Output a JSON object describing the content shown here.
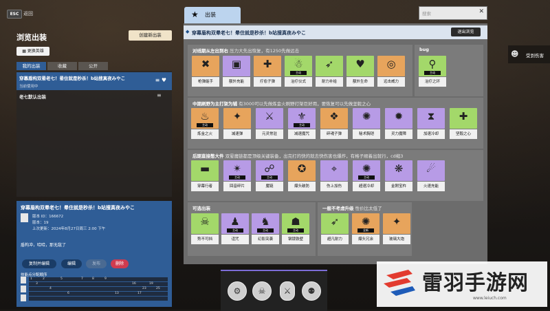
{
  "top": {
    "esc": "ESC",
    "back": "返回"
  },
  "left": {
    "title": "浏览出装",
    "new_button": "创建新出装",
    "swap_button": "更换英雄",
    "tabs": [
      {
        "label": "我的出装"
      },
      {
        "label": "收藏"
      },
      {
        "label": "公开"
      }
    ],
    "selected": {
      "title": "穿幕盾构双晕老七！晕住就是秒杀！b站搜真夜みやこ",
      "status": "当前使用中"
    },
    "default_build": "老七默认出装"
  },
  "card": {
    "title": "穿幕盾构双晕老七！晕住就是秒杀！b站搜真夜みやこ",
    "version_id": "版本 ID：166672",
    "version": "版本：19",
    "updated": "上次更新：2024年8月27日周三 2:00 下午",
    "desc": "盾构冲，哈哈，那无敌了",
    "buttons": {
      "copy_edit": "复制并编辑",
      "edit": "编辑",
      "publish": "发布",
      "delete": "删除"
    },
    "seq_label": "技能点分配顺序",
    "seq_row_labels": [
      [
        "1",
        "2",
        "5",
        "7",
        "8",
        "9",
        "10",
        "11",
        "12",
        "15"
      ],
      [
        "3",
        "16",
        "19",
        "21",
        "22"
      ],
      [
        "4",
        "23",
        "25",
        "26",
        "27"
      ],
      [
        "6",
        "13",
        "17",
        "18",
        "20"
      ]
    ]
  },
  "main": {
    "tab_label": "出装",
    "search_placeholder": "搜索",
    "build_name": "穿幕盾构双晕老七！晕住就是秒杀！b站搜真夜みやこ",
    "exit_button": "退出浏览",
    "sections": [
      {
        "title": "对线期从左出到右",
        "note": "压力大先出恢复，有1250先做远击",
        "items": [
          {
            "label": "枪弹能手",
            "color": "orange",
            "glyph": "✖"
          },
          {
            "label": "额外充能",
            "color": "purple",
            "glyph": "▣"
          },
          {
            "label": "疗愈子弹",
            "color": "orange",
            "glyph": "✚"
          },
          {
            "label": "治疗仪式",
            "color": "green",
            "glyph": "☃",
            "tag": "主动"
          },
          {
            "label": "耐力补给",
            "color": "green",
            "glyph": "➶"
          },
          {
            "label": "额外生命",
            "color": "green",
            "glyph": "♥"
          },
          {
            "label": "远击威力",
            "color": "orange",
            "glyph": "◎"
          }
        ]
      },
      {
        "title": "bug",
        "note": "",
        "items": [
          {
            "label": "治疗之环",
            "color": "green",
            "glyph": "⚲",
            "tag": "主动"
          }
        ]
      },
      {
        "title": "中期刷野为主打架为辅",
        "note": "有3000可以先做炼金火刷野打架巨好用，要恢复可以先做坚毅之心",
        "items": [
          {
            "label": "炼金之火",
            "color": "orange",
            "glyph": "♨",
            "tag": "主动"
          },
          {
            "label": "减速弹",
            "color": "orange",
            "glyph": "✦"
          },
          {
            "label": "元灵常驻",
            "color": "purple",
            "glyph": "⚔"
          },
          {
            "label": "减速魔咒",
            "color": "purple",
            "glyph": "⚜",
            "tag": "主动"
          },
          {
            "label": "碎魂子弹",
            "color": "orange",
            "glyph": "❖"
          },
          {
            "label": "秘术胸铠",
            "color": "purple",
            "glyph": "✺"
          },
          {
            "label": "灵力魔障",
            "color": "purple",
            "glyph": "✹"
          },
          {
            "label": "加速冷却",
            "color": "purple",
            "glyph": "⧗"
          },
          {
            "label": "坚毅之心",
            "color": "green",
            "glyph": "✚"
          }
        ]
      },
      {
        "title": "后期直接憋大件",
        "note": "双晕魔链都是顶级关键装备，出完打的快的就去快伤害也爆炸，有格子顺着出就行，cd缩3",
        "items": [
          {
            "label": "穿幕行者",
            "color": "green",
            "glyph": "▬"
          },
          {
            "label": "回音碎片",
            "color": "purple",
            "glyph": "✴",
            "tag": "主动"
          },
          {
            "label": "魔链",
            "color": "purple",
            "glyph": "☍",
            "tag": "主动"
          },
          {
            "label": "爆头破防",
            "color": "orange",
            "glyph": "✪"
          },
          {
            "label": "伤上加伤",
            "color": "purple",
            "glyph": "⌖"
          },
          {
            "label": "超速冷却",
            "color": "purple",
            "glyph": "✺",
            "tag": "主动"
          },
          {
            "label": "金刚宝杵",
            "color": "purple",
            "glyph": "❋"
          },
          {
            "label": "火速充能",
            "color": "purple",
            "glyph": "☄"
          }
        ]
      },
      {
        "title": "可选出装",
        "note": "",
        "items": [
          {
            "label": "势不可挡",
            "color": "green",
            "glyph": "☠"
          },
          {
            "label": "诅咒",
            "color": "purple",
            "glyph": "♟",
            "tag": "主动"
          },
          {
            "label": "幻影突袭",
            "color": "purple",
            "glyph": "♞",
            "tag": "主动"
          },
          {
            "label": "钢镜铁壁",
            "color": "green",
            "glyph": "☗",
            "tag": "主动"
          }
        ]
      },
      {
        "title": "一般不考虑升级",
        "note": "性价比太低了",
        "items": [
          {
            "label": "超凡耐力",
            "color": "green",
            "glyph": "➶"
          },
          {
            "label": "爆头冗余",
            "color": "orange",
            "glyph": "✺",
            "tag": "全新"
          },
          {
            "label": "玻璃大炮",
            "color": "orange",
            "glyph": "✦"
          }
        ]
      }
    ]
  },
  "damage_button": "受到伤害",
  "watermark": {
    "text": "雷羽手游网",
    "url": "www.leiuch.com"
  }
}
